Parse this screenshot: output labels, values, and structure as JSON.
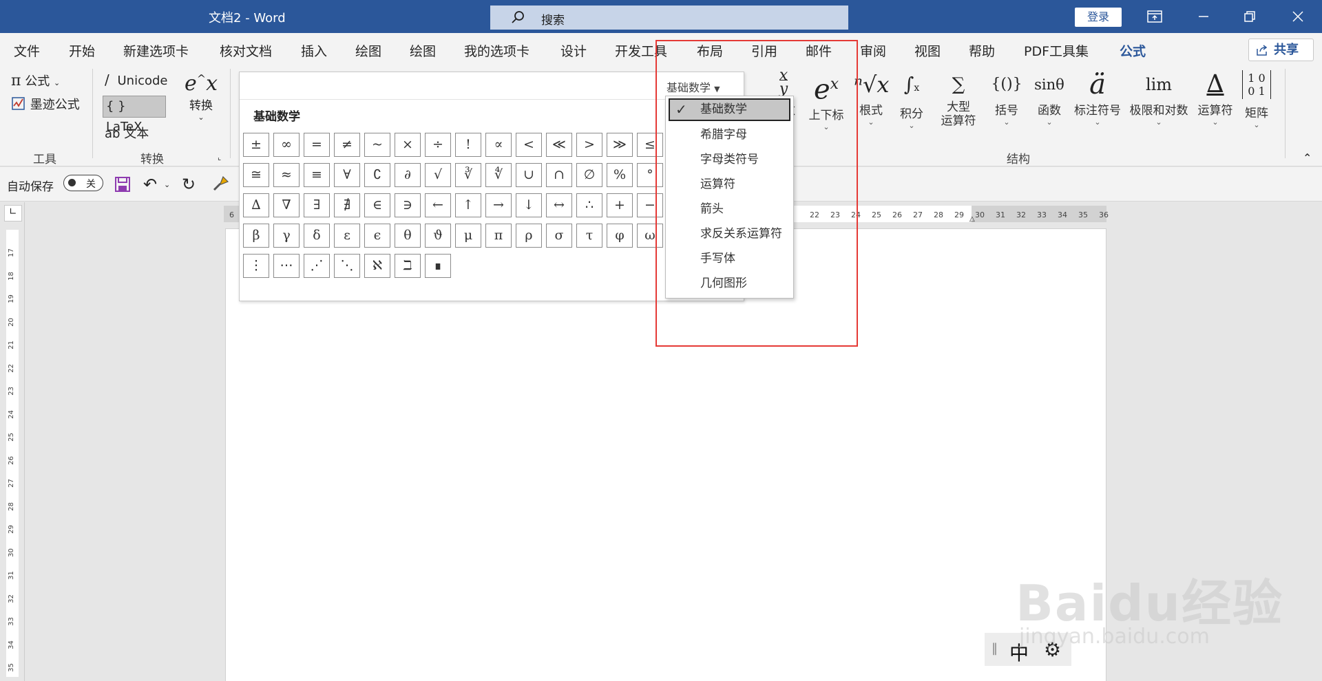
{
  "window": {
    "title": "文档2  -  Word",
    "search_placeholder": "搜索",
    "login": "登录"
  },
  "tabs": [
    "文件",
    "开始",
    "新建选项卡",
    "核对文档",
    "插入",
    "绘图",
    "绘图",
    "我的选项卡",
    "设计",
    "开发工具",
    "布局",
    "引用",
    "邮件",
    "审阅",
    "视图",
    "帮助",
    "PDF工具集",
    "公式"
  ],
  "active_tab": "公式",
  "share": "共享",
  "ribbon": {
    "tools": {
      "formula": "公式",
      "ink_formula": "墨迹公式",
      "group_label": "工具"
    },
    "convert": {
      "unicode": "Unicode",
      "latex": "LaTeX",
      "text": "文本",
      "convert_btn": "转换",
      "group_label": "转换"
    },
    "structures": {
      "group_label": "结构",
      "items": [
        {
          "label": "分数",
          "icon": "fraction-icon"
        },
        {
          "label": "上下标",
          "icon": "script-icon"
        },
        {
          "label": "根式",
          "icon": "radical-icon"
        },
        {
          "label": "积分",
          "icon": "integral-icon"
        },
        {
          "label": "大型",
          "label2": "运算符",
          "icon": "large-operator-icon"
        },
        {
          "label": "括号",
          "icon": "bracket-icon"
        },
        {
          "label": "函数",
          "icon": "function-icon"
        },
        {
          "label": "标注符号",
          "icon": "accent-icon"
        },
        {
          "label": "极限和对数",
          "icon": "limit-icon"
        },
        {
          "label": "运算符",
          "icon": "operator-icon"
        },
        {
          "label": "矩阵",
          "icon": "matrix-icon"
        }
      ]
    }
  },
  "qat": {
    "autosave": "自动保存",
    "toggle_state": "关"
  },
  "gallery": {
    "category_button": "基础数学",
    "title": "基础数学",
    "rows": [
      [
        "±",
        "∞",
        "=",
        "≠",
        "~",
        "×",
        "÷",
        "!",
        "∝",
        "<",
        "≪",
        ">",
        "≫",
        "≤"
      ],
      [
        "≅",
        "≈",
        "≡",
        "∀",
        "∁",
        "∂",
        "√",
        "∛",
        "∜",
        "∪",
        "∩",
        "∅",
        "%",
        "°"
      ],
      [
        "∆",
        "∇",
        "∃",
        "∄",
        "∈",
        "∋",
        "←",
        "↑",
        "→",
        "↓",
        "↔",
        "∴",
        "+",
        "−"
      ],
      [
        "β",
        "γ",
        "δ",
        "ε",
        "ϵ",
        "θ",
        "ϑ",
        "μ",
        "π",
        "ρ",
        "σ",
        "τ",
        "φ",
        "ω"
      ],
      [
        "⋮",
        "⋯",
        "⋰",
        "⋱",
        "ℵ",
        "ℶ",
        "∎"
      ]
    ]
  },
  "dropdown": {
    "items": [
      "基础数学",
      "希腊字母",
      "字母类符号",
      "运算符",
      "箭头",
      "求反关系运算符",
      "手写体",
      "几何图形"
    ],
    "selected": "基础数学"
  },
  "ruler": {
    "h_numbers": [
      "6",
      "1",
      "22",
      "23",
      "24",
      "25",
      "26",
      "27",
      "28",
      "29",
      "30",
      "31",
      "32",
      "33",
      "34",
      "35",
      "36"
    ],
    "v_numbers": [
      "17",
      "18",
      "19",
      "20",
      "21",
      "22",
      "23",
      "24",
      "25",
      "26",
      "27",
      "28",
      "29",
      "30",
      "31",
      "32",
      "33",
      "34",
      "35"
    ]
  },
  "ime": {
    "lang": "中"
  },
  "watermark": {
    "logo": "Baidu经验",
    "url": "jingyan.baidu.com"
  }
}
